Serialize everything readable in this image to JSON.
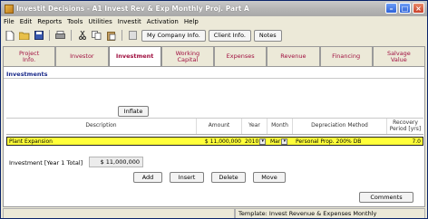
{
  "window": {
    "title": "Investit Decisions - A1 Invest Rev & Exp Monthly Proj. Part A"
  },
  "menu": [
    "File",
    "Edit",
    "Reports",
    "Tools",
    "Utilities",
    "Investit",
    "Activation",
    "Help"
  ],
  "toolbar": {
    "buttons": [
      "My Company Info.",
      "Client Info.",
      "Notes"
    ]
  },
  "tabs": [
    {
      "label": "Project\nInfo."
    },
    {
      "label": "Investor"
    },
    {
      "label": "Investment"
    },
    {
      "label": "Working\nCapital"
    },
    {
      "label": "Expenses"
    },
    {
      "label": "Revenue"
    },
    {
      "label": "Financing"
    },
    {
      "label": "Salvage\nValue"
    }
  ],
  "active_tab": "Investment",
  "section": {
    "title": "Investments",
    "inflate_label": "Inflate"
  },
  "table": {
    "headers": [
      "Description",
      "Amount",
      "Year",
      "Month",
      "Depreciation Method",
      "Recovery\nPeriod [yrs]"
    ],
    "row": {
      "description": "Plant Expansion",
      "amount": "$ 11,000,000",
      "year": "2010",
      "month": "Mar",
      "method": "Personal Prop. 200% DB",
      "recovery": "7.0"
    }
  },
  "total": {
    "label": "Investment [Year 1 Total]",
    "value": "$ 11,000,000"
  },
  "actions": [
    "Add",
    "Insert",
    "Delete",
    "Move"
  ],
  "comments_label": "Comments",
  "status": {
    "template": "Template: Invest Revenue & Expenses Monthly"
  }
}
